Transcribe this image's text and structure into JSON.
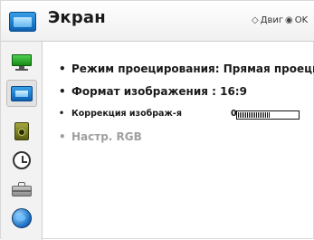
{
  "header": {
    "title": "Экран",
    "hint_move_label": "Двиг",
    "hint_ok_label": "OK"
  },
  "sidebar": {
    "items": [
      {
        "icon": "monitor-icon"
      },
      {
        "icon": "screen-icon",
        "active": true
      },
      {
        "icon": "speaker-icon"
      },
      {
        "icon": "clock-icon"
      },
      {
        "icon": "briefcase-icon"
      },
      {
        "icon": "globe-icon"
      }
    ]
  },
  "menu": {
    "projection_mode": "Режим проецирования: Прямая проеция",
    "aspect_ratio": "Формат изображения : 16:9",
    "keystone_label": "Коррекция изображ-я",
    "keystone_value": "0",
    "keystone_level": 0.55,
    "rgb_settings": "Настр. RGB"
  },
  "colors": {
    "accent_blue": "#0b5fb0",
    "disabled_text": "#a0a0a0"
  }
}
